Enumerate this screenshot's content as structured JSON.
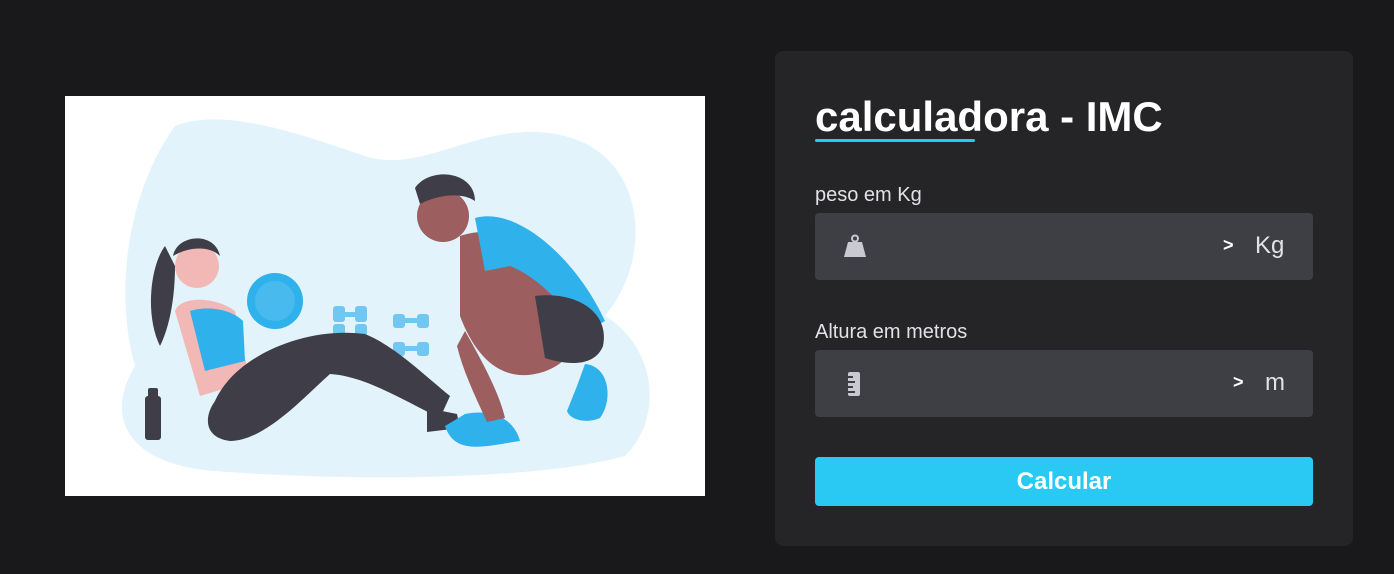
{
  "title": "calculadora - IMC",
  "accent_color": "#29c9f3",
  "illustration": {
    "icon": "workout-illustration"
  },
  "weight": {
    "label": "peso em Kg",
    "value": "",
    "placeholder": "",
    "icon": "weight-icon",
    "arrow": ">",
    "unit": "Kg"
  },
  "height": {
    "label": "Altura em metros",
    "value": "",
    "placeholder": "",
    "icon": "ruler-icon",
    "arrow": ">",
    "unit": "m"
  },
  "button": {
    "label": "Calcular"
  }
}
